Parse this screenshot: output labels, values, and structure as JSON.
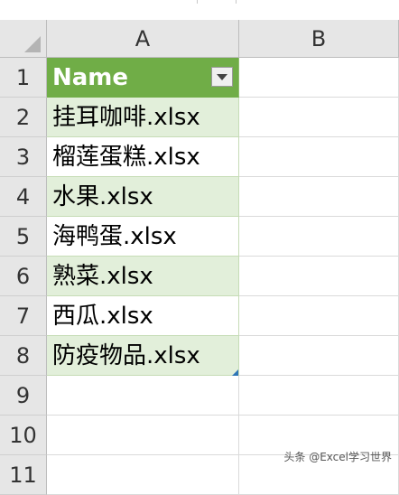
{
  "sheet": {
    "columns": [
      "A",
      "B"
    ],
    "row_numbers": [
      "1",
      "2",
      "3",
      "4",
      "5",
      "6",
      "7",
      "8",
      "9",
      "10",
      "11"
    ],
    "header_cell": "Name",
    "cells_a": [
      "挂耳咖啡.xlsx",
      "榴莲蛋糕.xlsx",
      "水果.xlsx",
      "海鸭蛋.xlsx",
      "熟菜.xlsx",
      "西瓜.xlsx",
      "防疫物品.xlsx"
    ],
    "table_style": {
      "header_color": "#70ad47",
      "band_color": "#e2efda"
    }
  },
  "watermark": "头条 @Excel学习世界"
}
